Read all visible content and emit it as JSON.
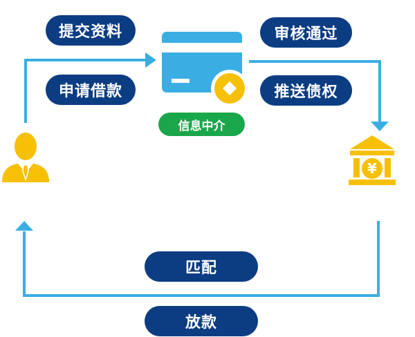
{
  "steps": {
    "submit": "提交资料",
    "apply": "申请借款",
    "review": "审核通过",
    "push": "推送债权",
    "match": "匹配",
    "lend": "放款"
  },
  "intermediary": {
    "label": "信息中介"
  },
  "icons": {
    "card": "credit-card-icon",
    "coin": "coin-icon",
    "borrower": "person-icon",
    "bank": "bank-icon",
    "bank_symbol": "¥"
  },
  "colors": {
    "arrow": "#3aaee3",
    "pill": "#0c3d82",
    "card": "#3aaee3",
    "gold": "#f6c007",
    "green": "#1aa64a"
  }
}
